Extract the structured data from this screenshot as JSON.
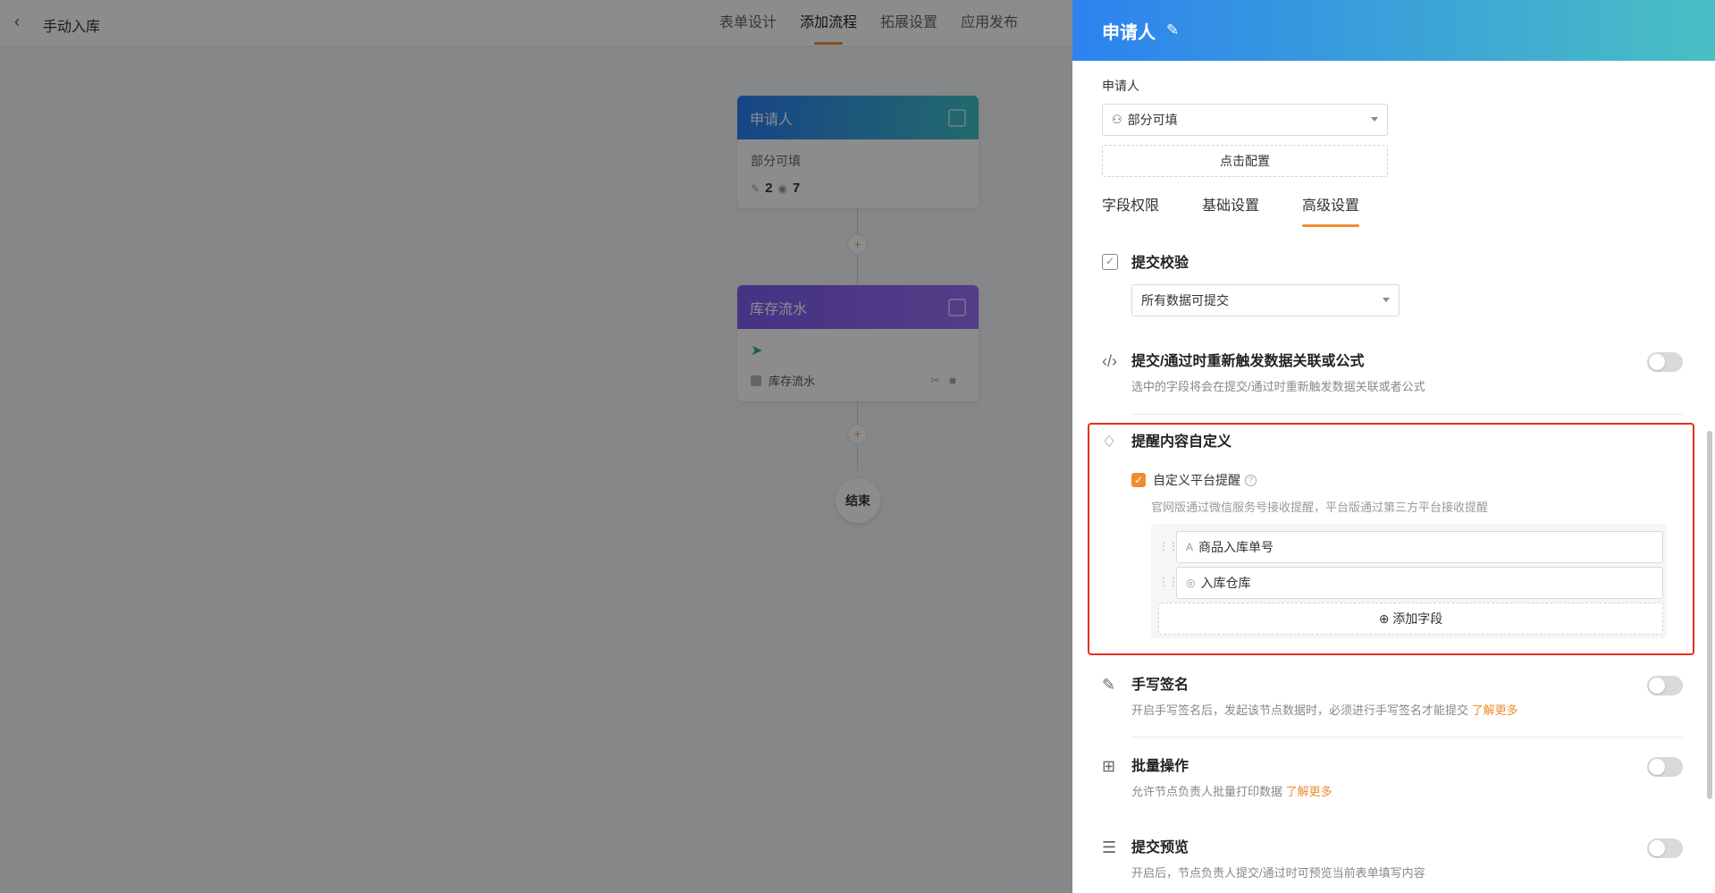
{
  "header": {
    "back_icon": "chevron-left-icon",
    "title": "手动入库",
    "tabs": [
      {
        "label": "表单设计"
      },
      {
        "label": "添加流程",
        "active": true
      },
      {
        "label": "拓展设置"
      },
      {
        "label": "应用发布"
      }
    ]
  },
  "flow": {
    "applicant_node": {
      "title": "申请人",
      "desc": "部分可填",
      "edit_count": "2",
      "view_count": "7"
    },
    "stock_node": {
      "title": "库存流水",
      "item": "库存流水"
    },
    "add_label": "+",
    "end_label": "结束"
  },
  "drawer": {
    "title": "申请人",
    "applicant_label": "申请人",
    "permission_select": "部分可填",
    "config_button": "点击配置",
    "sub_tabs": [
      "字段权限",
      "基础设置",
      "高级设置"
    ],
    "active_sub_tab": "高级设置",
    "submit_check": {
      "title": "提交校验",
      "select": "所有数据可提交"
    },
    "retrigger": {
      "title": "提交/通过时重新触发数据关联或公式",
      "desc": "选中的字段将会在提交/通过时重新触发数据关联或者公式",
      "enabled": false
    },
    "reminder": {
      "title": "提醒内容自定义",
      "custom_label": "自定义平台提醒",
      "custom_checked": true,
      "desc": "官网版通过微信服务号接收提醒，平台版通过第三方平台接收提醒",
      "fields": [
        {
          "icon": "text-field-icon",
          "label": "商品入库单号"
        },
        {
          "icon": "link-field-icon",
          "label": "入库仓库"
        }
      ],
      "add_field": "添加字段"
    },
    "signature": {
      "title": "手写签名",
      "desc": "开启手写签名后，发起该节点数据时，必须进行手写签名才能提交",
      "link": "了解更多",
      "enabled": false
    },
    "batch": {
      "title": "批量操作",
      "desc": "允许节点负责人批量打印数据",
      "link": "了解更多",
      "enabled": false
    },
    "preview": {
      "title": "提交预览",
      "desc": "开启后，节点负责人提交/通过时可预览当前表单填写内容",
      "enabled": false
    }
  },
  "colors": {
    "accent": "#f08c2f",
    "highlight": "#e5301d",
    "header_gradient_start": "#2d82ef",
    "header_gradient_end": "#49bfc3"
  }
}
